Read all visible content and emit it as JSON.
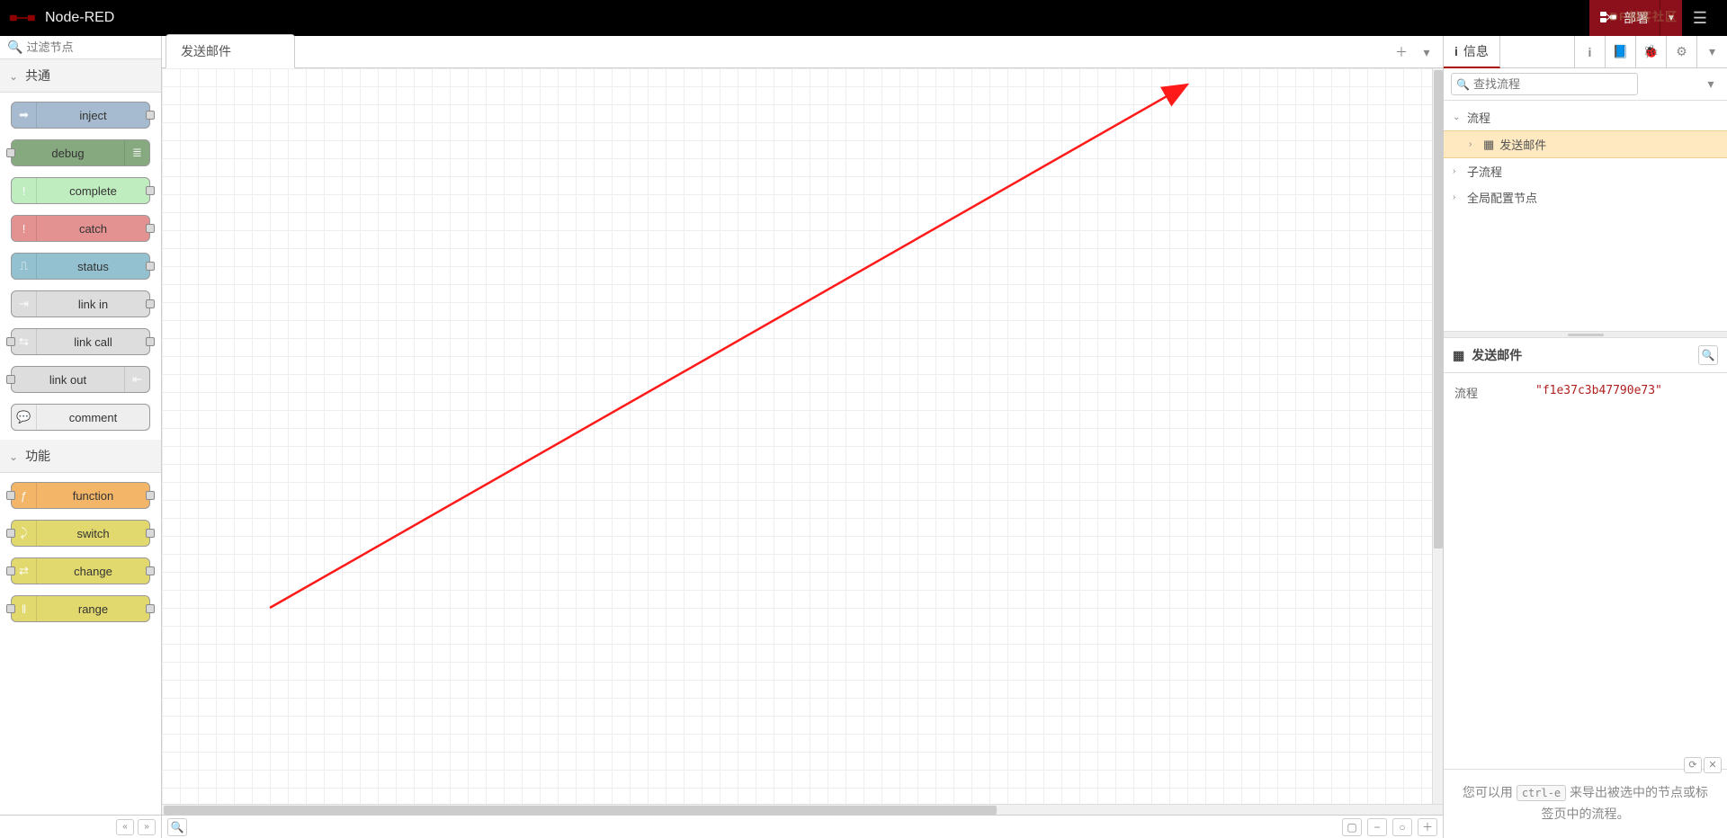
{
  "header": {
    "title": "Node-RED",
    "deploy_label": "部署",
    "watermark": "DF创客社区"
  },
  "palette": {
    "filter_placeholder": "过滤节点",
    "categories": [
      {
        "label": "共通",
        "nodes": [
          {
            "label": "inject",
            "bg": "#a6bbcf",
            "icon": "➡",
            "port_l": false,
            "port_r": true,
            "icon_side": "l"
          },
          {
            "label": "debug",
            "bg": "#87a980",
            "icon": "≣",
            "port_l": true,
            "port_r": false,
            "icon_side": "r"
          },
          {
            "label": "complete",
            "bg": "#c0edc0",
            "icon": "!",
            "port_l": false,
            "port_r": true,
            "icon_side": "l"
          },
          {
            "label": "catch",
            "bg": "#e49191",
            "icon": "!",
            "port_l": false,
            "port_r": true,
            "icon_side": "l"
          },
          {
            "label": "status",
            "bg": "#94c1d0",
            "icon": "⎍",
            "port_l": false,
            "port_r": true,
            "icon_side": "l"
          },
          {
            "label": "link in",
            "bg": "#ddd",
            "icon": "⇥",
            "port_l": false,
            "port_r": true,
            "icon_side": "l"
          },
          {
            "label": "link call",
            "bg": "#ddd",
            "icon": "⇆",
            "port_l": true,
            "port_r": true,
            "icon_side": "l"
          },
          {
            "label": "link out",
            "bg": "#ddd",
            "icon": "⇤",
            "port_l": true,
            "port_r": false,
            "icon_side": "r"
          },
          {
            "label": "comment",
            "bg": "#eee",
            "icon": "💬",
            "port_l": false,
            "port_r": false,
            "icon_side": "l"
          }
        ]
      },
      {
        "label": "功能",
        "nodes": [
          {
            "label": "function",
            "bg": "#f3b568",
            "icon": "ƒ",
            "port_l": true,
            "port_r": true,
            "icon_side": "l"
          },
          {
            "label": "switch",
            "bg": "#e2d96e",
            "icon": "⤸",
            "port_l": true,
            "port_r": true,
            "icon_side": "l"
          },
          {
            "label": "change",
            "bg": "#e2d96e",
            "icon": "⇄",
            "port_l": true,
            "port_r": true,
            "icon_side": "l"
          },
          {
            "label": "range",
            "bg": "#e2d96e",
            "icon": "‖",
            "port_l": true,
            "port_r": true,
            "icon_side": "l"
          }
        ]
      }
    ]
  },
  "workspace": {
    "tab_label": "发送邮件"
  },
  "sidebar": {
    "active_tab_label": "信息",
    "search_placeholder": "查找流程",
    "tree": {
      "flows_label": "流程",
      "flow_item_label": "发送邮件",
      "subflows_label": "子流程",
      "global_config_label": "全局配置节点"
    },
    "detail": {
      "title": "发送邮件",
      "prop_key": "流程",
      "prop_val": "\"f1e37c3b47790e73\""
    },
    "tip": {
      "prefix": "您可以用 ",
      "kbd": "ctrl-e",
      "suffix": " 来导出被选中的节点或标签页中的流程。"
    }
  }
}
